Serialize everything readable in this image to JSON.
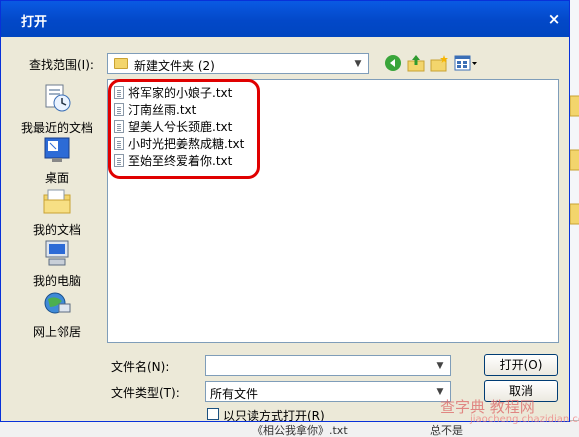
{
  "dialog": {
    "title": "打开",
    "close_symbol": "×"
  },
  "lookin": {
    "label": "查找范围(I):",
    "value": "新建文件夹 (2)"
  },
  "toolbar": {
    "icons": [
      "back-icon",
      "up-folder-icon",
      "new-folder-icon",
      "view-menu-icon"
    ]
  },
  "places": [
    {
      "label": "我最近的文档",
      "icon": "recent-documents-icon"
    },
    {
      "label": "桌面",
      "icon": "desktop-icon"
    },
    {
      "label": "我的文档",
      "icon": "my-documents-icon"
    },
    {
      "label": "我的电脑",
      "icon": "my-computer-icon"
    },
    {
      "label": "网上邻居",
      "icon": "network-places-icon"
    }
  ],
  "files": [
    "将军家的小娘子.txt",
    "汀南丝雨.txt",
    "望美人兮长颈鹿.txt",
    "小时光把姜熬成糖.txt",
    "至始至终爱着你.txt"
  ],
  "filename": {
    "label": "文件名(N):",
    "value": ""
  },
  "filetype": {
    "label": "文件类型(T):",
    "value": "所有文件"
  },
  "buttons": {
    "open": "打开(O)",
    "cancel": "取消"
  },
  "readonly": {
    "label": "以只读方式打开(R)",
    "checked": false
  },
  "background": {
    "strip_text": "《相公我拿你》.txt",
    "strip_text_right": "总不是"
  },
  "watermark": {
    "text": "查字典 教程网",
    "subtext": "jiaocheng.chazidian.com"
  },
  "colors": {
    "titlebar": "#0a5ae3",
    "highlight": "#e00000",
    "dialog_bg": "#ece9d8"
  }
}
